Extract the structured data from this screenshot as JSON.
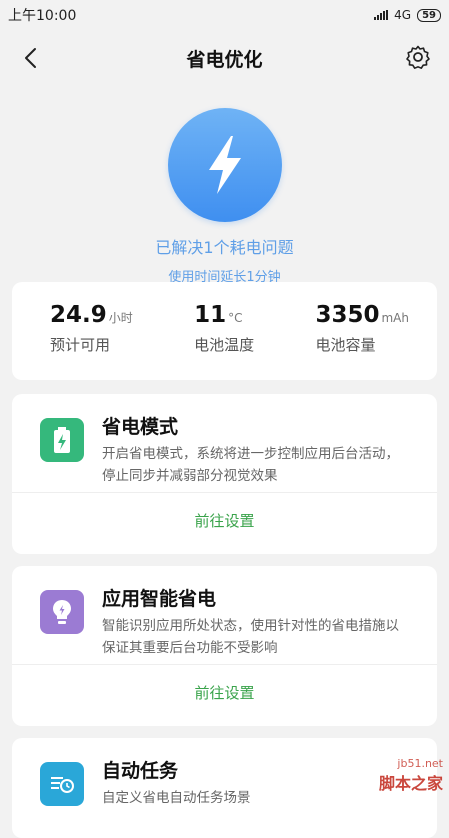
{
  "status": {
    "time": "上午10:00",
    "network": "4G",
    "battery": "59"
  },
  "header": {
    "title": "省电优化"
  },
  "hero": {
    "line1": "已解决1个耗电问题",
    "line2": "使用时间延长1分钟"
  },
  "stats": [
    {
      "value": "24.9",
      "unit": "小时",
      "label": "预计可用"
    },
    {
      "value": "11",
      "unit": "°C",
      "label": "电池温度"
    },
    {
      "value": "3350",
      "unit": "mAh",
      "label": "电池容量"
    }
  ],
  "features": [
    {
      "title": "省电模式",
      "desc": "开启省电模式，系统将进一步控制应用后台活动，停止同步并减弱部分视觉效果",
      "action": "前往设置",
      "icon": "battery-bolt-icon",
      "color": "#35b87c"
    },
    {
      "title": "应用智能省电",
      "desc": "智能识别应用所处状态，使用针对性的省电措施以保证其重要后台功能不受影响",
      "action": "前往设置",
      "icon": "bulb-icon",
      "color": "#9b7bd3"
    },
    {
      "title": "自动任务",
      "desc": "自定义省电自动任务场景",
      "icon": "task-icon",
      "color": "#2aa7d8"
    }
  ],
  "watermark": {
    "site": "jb51.net",
    "brand": "脚本之家"
  }
}
